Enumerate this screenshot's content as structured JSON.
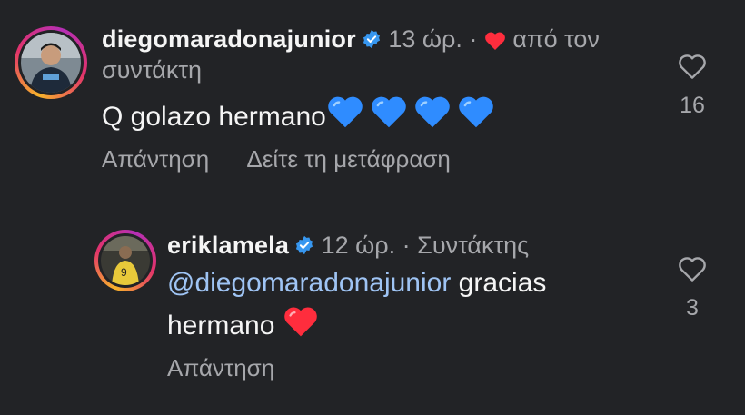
{
  "comments": [
    {
      "username": "diegomaradonajunior",
      "time": "13 ώρ.",
      "separator": "·",
      "liked_by_author": "από τον",
      "liked_by_author_cont": "συντάκτη",
      "text": "Q golazo hermano",
      "emojis": [
        "blue-heart",
        "blue-heart",
        "blue-heart",
        "blue-heart"
      ],
      "reply_label": "Απάντηση",
      "translate_label": "Δείτε τη μετάφραση",
      "like_count": "16"
    },
    {
      "username": "eriklamela",
      "time": "12 ώρ.",
      "separator": "·",
      "author_badge": "Συντάκτης",
      "mention": "@diegomaradonajunior",
      "text_after_mention": "gracias",
      "text_line2": "hermano",
      "emojis": [
        "red-heart"
      ],
      "reply_label": "Απάντηση",
      "like_count": "3"
    }
  ],
  "colors": {
    "background": "#222326",
    "text": "#f5f5f5",
    "muted": "#a6a7ab",
    "mention": "#9fc4f4",
    "verified": "#3797f0",
    "red_heart": "#ff2d3d",
    "blue_heart": "#2f8cff"
  }
}
